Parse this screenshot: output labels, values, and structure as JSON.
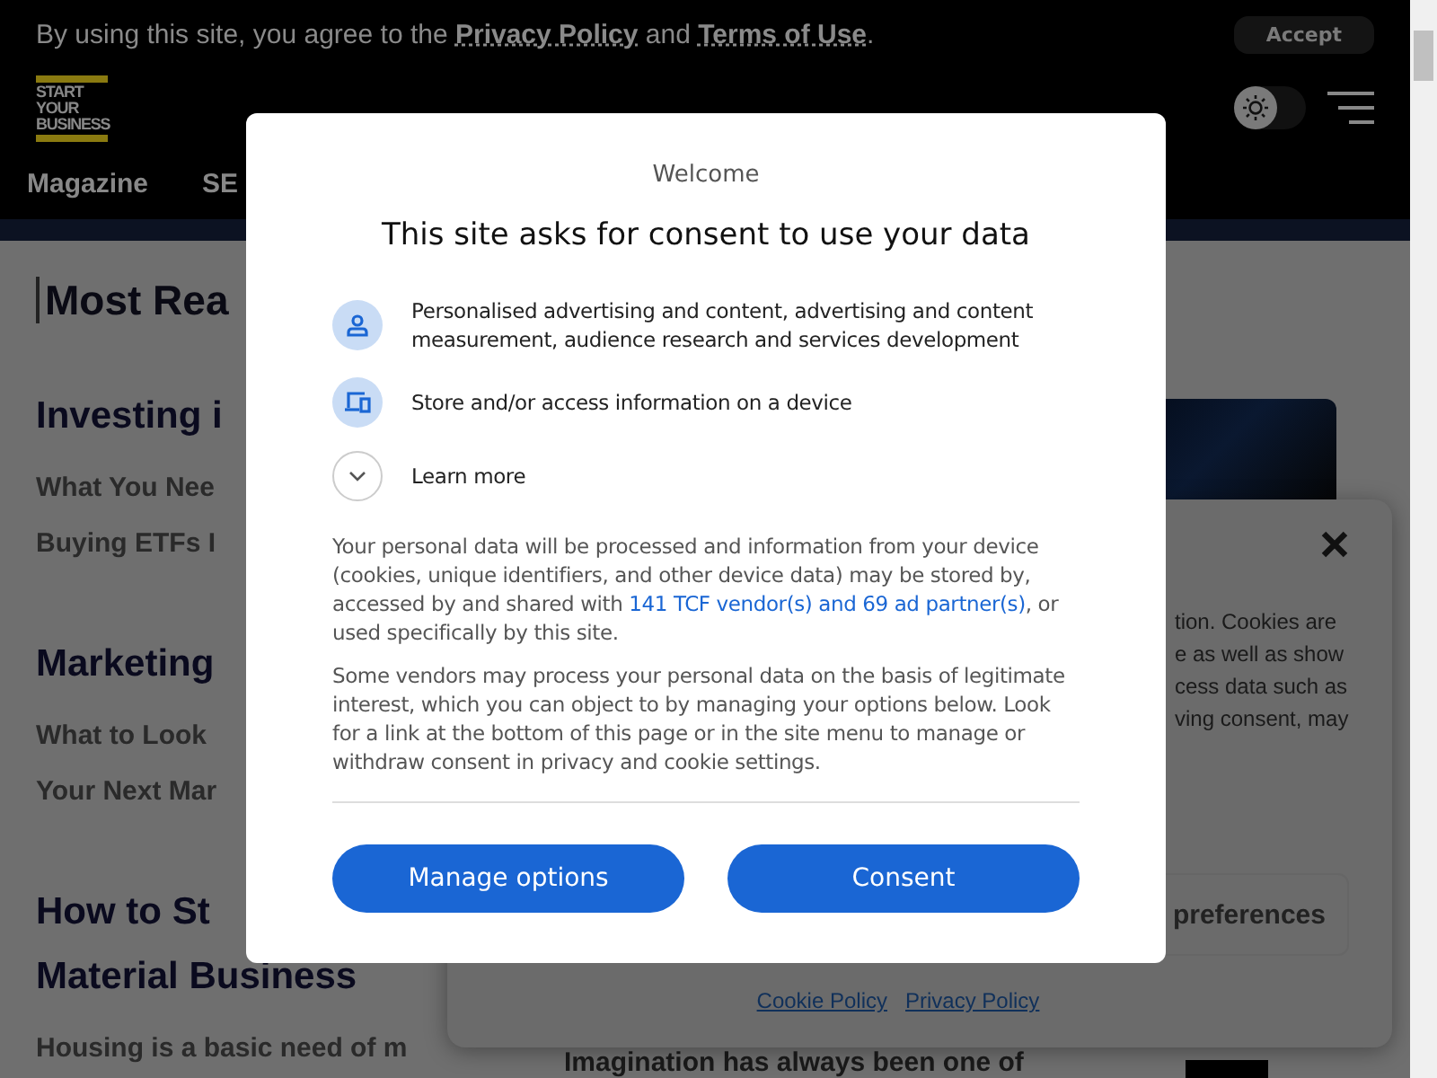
{
  "notice_bar": {
    "text_before": "By using this site, you agree to the",
    "privacy_link": "Privacy Policy",
    "text_middle": "and",
    "terms_link": "Terms of Use",
    "text_after": ".",
    "accept_button": "Accept"
  },
  "header": {
    "logo": [
      "START",
      "YOUR",
      "BUSINESS"
    ],
    "theme_toggle": {
      "on": false
    },
    "nav": [
      "Magazine",
      "SE"
    ]
  },
  "article_list": {
    "title": "Most Rea",
    "sections": [
      {
        "heading": "Investing i",
        "links": [
          "What You Nee",
          "Buying ETFs I"
        ]
      },
      {
        "heading": "Marketing",
        "links": [
          "What to Look",
          "Your Next Mar"
        ]
      },
      {
        "heading": "How to St",
        "heading_line_2": "Material Business",
        "links": [
          "Housing is a basic need of m"
        ]
      }
    ],
    "side_text": "Imagination has always been one of"
  },
  "cookie_panel": {
    "lines": [
      "tion. Cookies are",
      "e as well as show",
      "cess data such as",
      "ving consent, may"
    ],
    "preferences_button": "preferences",
    "links": [
      "Cookie Policy",
      "Privacy Policy"
    ]
  },
  "consent_dialog": {
    "subtitle": "Welcome",
    "title": "This site asks for consent to use your data",
    "purposes": [
      {
        "kind": "person",
        "text": "Personalised advertising and content, advertising and content measurement, audience research and services development"
      },
      {
        "kind": "devices",
        "text": "Store and/or access information on a device"
      },
      {
        "kind": "expand",
        "text": "Learn more",
        "expanded": false
      }
    ],
    "paragraph_1": {
      "before": "Your personal data will be processed and information from your device (cookies, unique identifiers, and other device data) may be stored by, accessed by and shared with",
      "link": "141 TCF vendor(s) and 69 ad partner(s)",
      "after": ", or used specifically by this site."
    },
    "paragraph_2": "Some vendors may process your personal data on the basis of legitimate interest, which you can object to by managing your options below. Look for a link at the bottom of this page or in the site menu to manage or withdraw consent in privacy and cookie settings.",
    "buttons": [
      "Manage options",
      "Consent"
    ]
  }
}
